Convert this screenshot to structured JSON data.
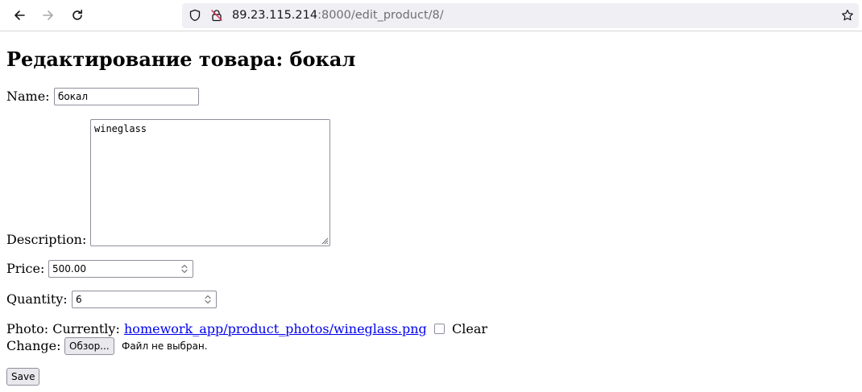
{
  "browser": {
    "url_host": "89.23.115.214",
    "url_path": ":8000/edit_product/8/"
  },
  "page": {
    "title": "Редактирование товара: бокал"
  },
  "form": {
    "name_label": "Name:",
    "name_value": "бокал",
    "description_label": "Description:",
    "description_value": "wineglass",
    "price_label": "Price:",
    "price_value": "500.00",
    "quantity_label": "Quantity:",
    "quantity_value": "6",
    "photo_label": "Photo: Currently:",
    "photo_link": "homework_app/product_photos/wineglass.png",
    "clear_label": "Clear",
    "change_label": "Change:",
    "browse_button": "Обзор...",
    "no_file_text": "Файл не выбран.",
    "save_button": "Save"
  },
  "colors": {
    "link": "#0000ee",
    "urlbar_bg": "#f0f0f4",
    "button_bg": "#e9e9ed"
  },
  "icons": [
    "back-arrow-icon",
    "forward-arrow-icon",
    "reload-icon",
    "shield-icon",
    "insecure-lock-icon",
    "bookmark-star-icon",
    "spinner-arrows-icon",
    "resize-grip-icon"
  ]
}
